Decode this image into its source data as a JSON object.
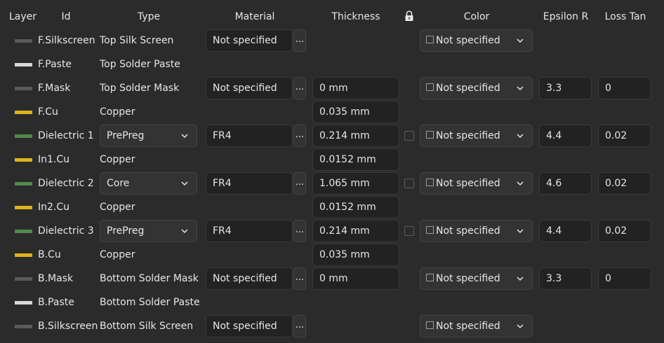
{
  "headers": {
    "layer": "Layer",
    "id": "Id",
    "type": "Type",
    "material": "Material",
    "thickness": "Thickness",
    "color": "Color",
    "epsilon": "Epsilon R",
    "loss": "Loss Tan"
  },
  "layer_colors": {
    "silk": "#5a5a5a",
    "paste": "#d8d8d8",
    "mask": "#5a5a5a",
    "copper": "#e0b31c",
    "dielectric": "#4f8a4a"
  },
  "rows": [
    {
      "id": "F.Silkscreen",
      "type": "Top Silk Screen",
      "material": "Not specified",
      "color": "Not specified"
    },
    {
      "id": "F.Paste",
      "type": "Top Solder Paste"
    },
    {
      "id": "F.Mask",
      "type": "Top Solder Mask",
      "material": "Not specified",
      "thickness": "0 mm",
      "color": "Not specified",
      "epsilon": "3.3",
      "loss": "0"
    },
    {
      "id": "F.Cu",
      "type": "Copper",
      "thickness": "0.035 mm"
    },
    {
      "id": "Dielectric 1",
      "type": "PrePreg",
      "material": "FR4",
      "thickness": "0.214 mm",
      "color": "Not specified",
      "epsilon": "4.4",
      "loss": "0.02"
    },
    {
      "id": "In1.Cu",
      "type": "Copper",
      "thickness": "0.0152 mm"
    },
    {
      "id": "Dielectric 2",
      "type": "Core",
      "material": "FR4",
      "thickness": "1.065 mm",
      "color": "Not specified",
      "epsilon": "4.6",
      "loss": "0.02"
    },
    {
      "id": "In2.Cu",
      "type": "Copper",
      "thickness": "0.0152 mm"
    },
    {
      "id": "Dielectric 3",
      "type": "PrePreg",
      "material": "FR4",
      "thickness": "0.214 mm",
      "color": "Not specified",
      "epsilon": "4.4",
      "loss": "0.02"
    },
    {
      "id": "B.Cu",
      "type": "Copper",
      "thickness": "0.035 mm"
    },
    {
      "id": "B.Mask",
      "type": "Bottom Solder Mask",
      "material": "Not specified",
      "thickness": "0 mm",
      "color": "Not specified",
      "epsilon": "3.3",
      "loss": "0"
    },
    {
      "id": "B.Paste",
      "type": "Bottom Solder Paste"
    },
    {
      "id": "B.Silkscreen",
      "type": "Bottom Silk Screen",
      "material": "Not specified",
      "color": "Not specified"
    }
  ],
  "material_button_label": "...",
  "icons": {
    "lock": "lock-icon",
    "chevron": "chevron-down-icon"
  }
}
